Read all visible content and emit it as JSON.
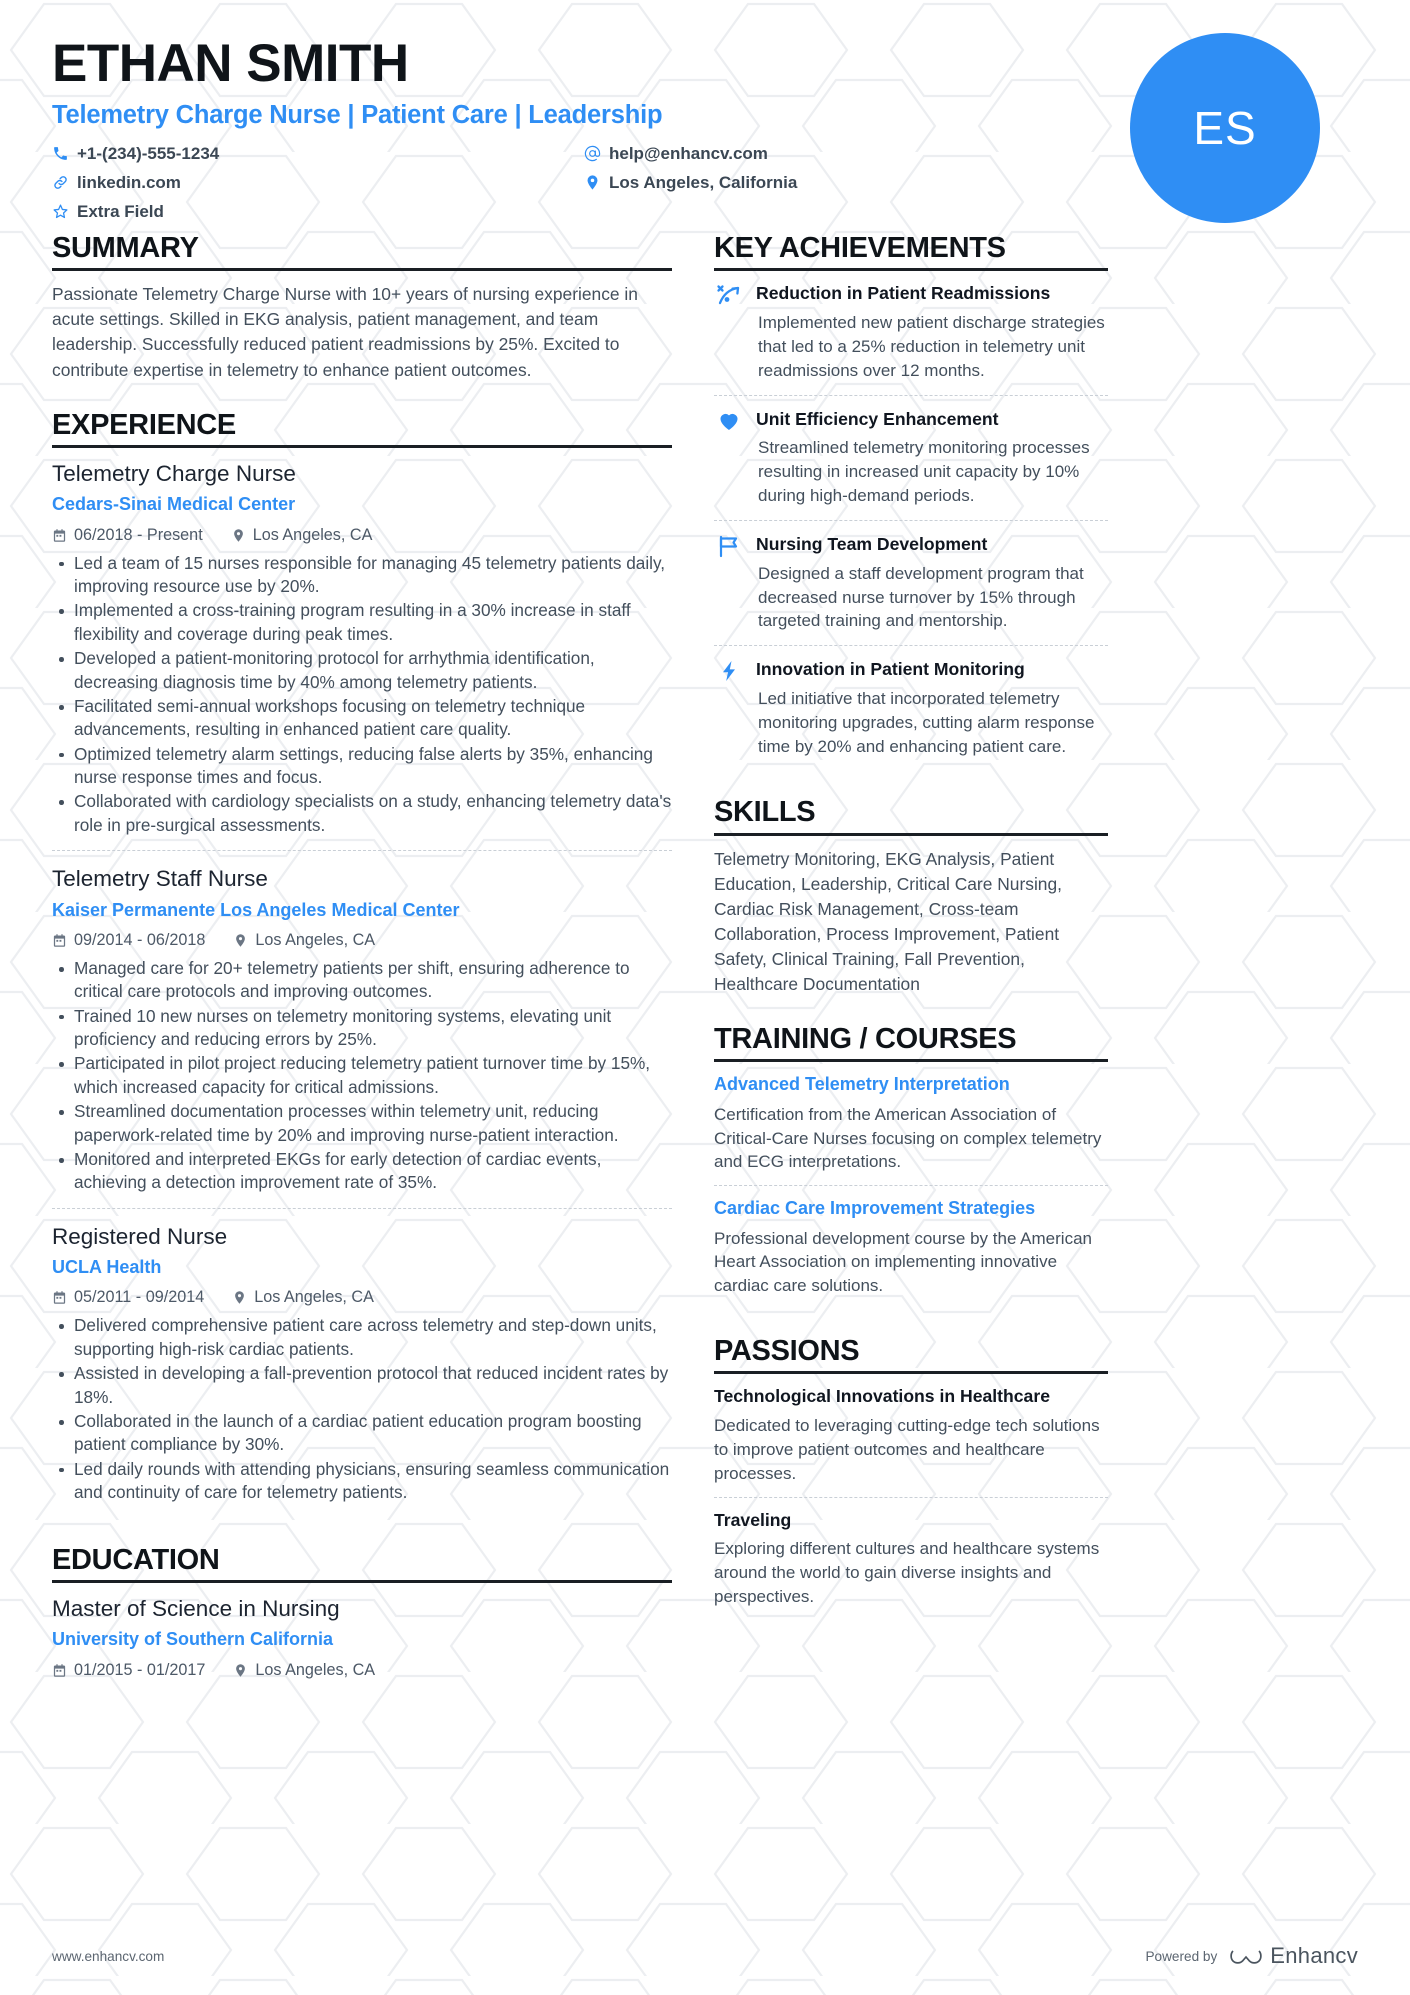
{
  "header": {
    "name": "ETHAN SMITH",
    "headline": "Telemetry Charge Nurse | Patient Care | Leadership",
    "avatar_initials": "ES",
    "accent_color": "#2f8ef4",
    "contacts": [
      {
        "icon": "phone-icon",
        "value": "+1-(234)-555-1234"
      },
      {
        "icon": "at-icon",
        "value": "help@enhancv.com"
      },
      {
        "icon": "link-icon",
        "value": "linkedin.com"
      },
      {
        "icon": "location-pin-icon",
        "value": "Los Angeles, California"
      },
      {
        "icon": "star-icon",
        "value": "Extra Field"
      }
    ]
  },
  "summary": {
    "title": "SUMMARY",
    "text": "Passionate Telemetry Charge Nurse with 10+ years of nursing experience in acute settings. Skilled in EKG analysis, patient management, and team leadership. Successfully reduced patient readmissions by 25%. Excited to contribute expertise in telemetry to enhance patient outcomes."
  },
  "experience": {
    "title": "EXPERIENCE",
    "entries": [
      {
        "role": "Telemetry Charge Nurse",
        "org": "Cedars-Sinai Medical Center",
        "dates": "06/2018 - Present",
        "location": "Los Angeles, CA",
        "bullets": [
          "Led a team of 15 nurses responsible for managing 45 telemetry patients daily, improving resource use by 20%.",
          "Implemented a cross-training program resulting in a 30% increase in staff flexibility and coverage during peak times.",
          "Developed a patient-monitoring protocol for arrhythmia identification, decreasing diagnosis time by 40% among telemetry patients.",
          "Facilitated semi-annual workshops focusing on telemetry technique advancements, resulting in enhanced patient care quality.",
          "Optimized telemetry alarm settings, reducing false alerts by 35%, enhancing nurse response times and focus.",
          "Collaborated with cardiology specialists on a study, enhancing telemetry data's role in pre-surgical assessments."
        ]
      },
      {
        "role": "Telemetry Staff Nurse",
        "org": "Kaiser Permanente Los Angeles Medical Center",
        "dates": "09/2014 - 06/2018",
        "location": "Los Angeles, CA",
        "bullets": [
          "Managed care for 20+ telemetry patients per shift, ensuring adherence to critical care protocols and improving outcomes.",
          "Trained 10 new nurses on telemetry monitoring systems, elevating unit proficiency and reducing errors by 25%.",
          "Participated in pilot project reducing telemetry patient turnover time by 15%, which increased capacity for critical admissions.",
          "Streamlined documentation processes within telemetry unit, reducing paperwork-related time by 20% and improving nurse-patient interaction.",
          "Monitored and interpreted EKGs for early detection of cardiac events, achieving a detection improvement rate of 35%."
        ]
      },
      {
        "role": "Registered Nurse",
        "org": "UCLA Health",
        "dates": "05/2011 - 09/2014",
        "location": "Los Angeles, CA",
        "bullets": [
          "Delivered comprehensive patient care across telemetry and step-down units, supporting high-risk cardiac patients.",
          "Assisted in developing a fall-prevention protocol that reduced incident rates by 18%.",
          "Collaborated in the launch of a cardiac patient education program boosting patient compliance by 30%.",
          "Led daily rounds with attending physicians, ensuring seamless communication and continuity of care for telemetry patients."
        ]
      }
    ]
  },
  "education": {
    "title": "EDUCATION",
    "entries": [
      {
        "degree": "Master of Science in Nursing",
        "school": "University of Southern California",
        "dates": "01/2015 - 01/2017",
        "location": "Los Angeles, CA"
      }
    ]
  },
  "achievements": {
    "title": "KEY ACHIEVEMENTS",
    "items": [
      {
        "icon": "rocket-trend-icon",
        "title": "Reduction in Patient Readmissions",
        "desc": "Implemented new patient discharge strategies that led to a 25% reduction in telemetry unit readmissions over 12 months."
      },
      {
        "icon": "heart-icon",
        "title": "Unit Efficiency Enhancement",
        "desc": "Streamlined telemetry monitoring processes resulting in increased unit capacity by 10% during high-demand periods."
      },
      {
        "icon": "flag-icon",
        "title": "Nursing Team Development",
        "desc": "Designed a staff development program that decreased nurse turnover by 15% through targeted training and mentorship."
      },
      {
        "icon": "lightning-bolt-icon",
        "title": "Innovation in Patient Monitoring",
        "desc": "Led initiative that incorporated telemetry monitoring upgrades, cutting alarm response time by 20% and enhancing patient care."
      }
    ]
  },
  "skills": {
    "title": "SKILLS",
    "text": "Telemetry Monitoring, EKG Analysis, Patient Education, Leadership, Critical Care Nursing, Cardiac Risk Management, Cross-team Collaboration, Process Improvement, Patient Safety, Clinical Training, Fall Prevention, Healthcare Documentation"
  },
  "training": {
    "title": "TRAINING / COURSES",
    "items": [
      {
        "title": "Advanced Telemetry Interpretation",
        "desc": "Certification from the American Association of Critical-Care Nurses focusing on complex telemetry and ECG interpretations."
      },
      {
        "title": "Cardiac Care Improvement Strategies",
        "desc": "Professional development course by the American Heart Association on implementing innovative cardiac care solutions."
      }
    ]
  },
  "passions": {
    "title": "PASSIONS",
    "items": [
      {
        "title": "Technological Innovations in Healthcare",
        "desc": "Dedicated to leveraging cutting-edge tech solutions to improve patient outcomes and healthcare processes."
      },
      {
        "title": "Traveling",
        "desc": "Exploring different cultures and healthcare systems around the world to gain diverse insights and perspectives."
      }
    ]
  },
  "footer": {
    "site": "www.enhancv.com",
    "powered_by": "Powered by",
    "brand": "Enhancv"
  }
}
